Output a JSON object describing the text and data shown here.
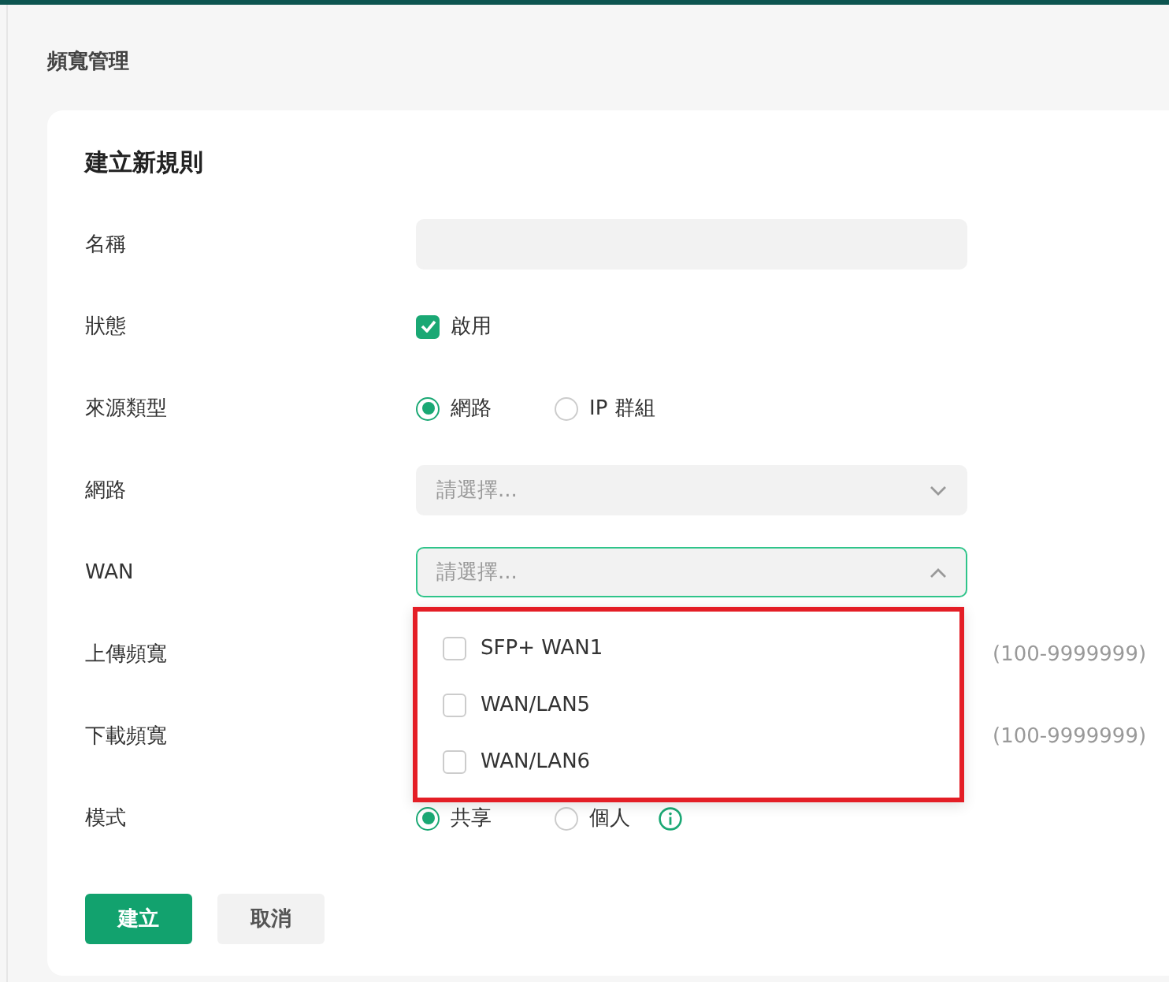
{
  "page_title": "頻寬管理",
  "form": {
    "title": "建立新規則",
    "rows": [
      {
        "label": "名稱",
        "kind": "text"
      },
      {
        "label": "狀態",
        "kind": "checkbox",
        "option": {
          "label": "啟用",
          "checked": true
        }
      },
      {
        "label": "來源類型",
        "kind": "radio",
        "options": [
          {
            "label": "網路",
            "selected": true
          },
          {
            "label": "IP 群組",
            "selected": false
          }
        ]
      },
      {
        "label": "網路",
        "kind": "select",
        "placeholder": "請選擇...",
        "expanded": false
      },
      {
        "label": "WAN",
        "kind": "select",
        "placeholder": "請選擇...",
        "expanded": true,
        "menu": {
          "highlighted": true,
          "items": [
            {
              "label": "SFP+ WAN1",
              "checked": false
            },
            {
              "label": "WAN/LAN5",
              "checked": false
            },
            {
              "label": "WAN/LAN6",
              "checked": false
            }
          ]
        }
      },
      {
        "label": "上傳頻寬",
        "kind": "hint",
        "hint": "(100-9999999)"
      },
      {
        "label": "下載頻寬",
        "kind": "hint",
        "hint": "(100-9999999)"
      },
      {
        "label": "模式",
        "kind": "radio",
        "info": true,
        "options": [
          {
            "label": "共享",
            "selected": true
          },
          {
            "label": "個人",
            "selected": false
          }
        ]
      }
    ],
    "buttons": [
      {
        "label": "建立",
        "kind": "primary"
      },
      {
        "label": "取消",
        "kind": "secondary"
      }
    ]
  }
}
